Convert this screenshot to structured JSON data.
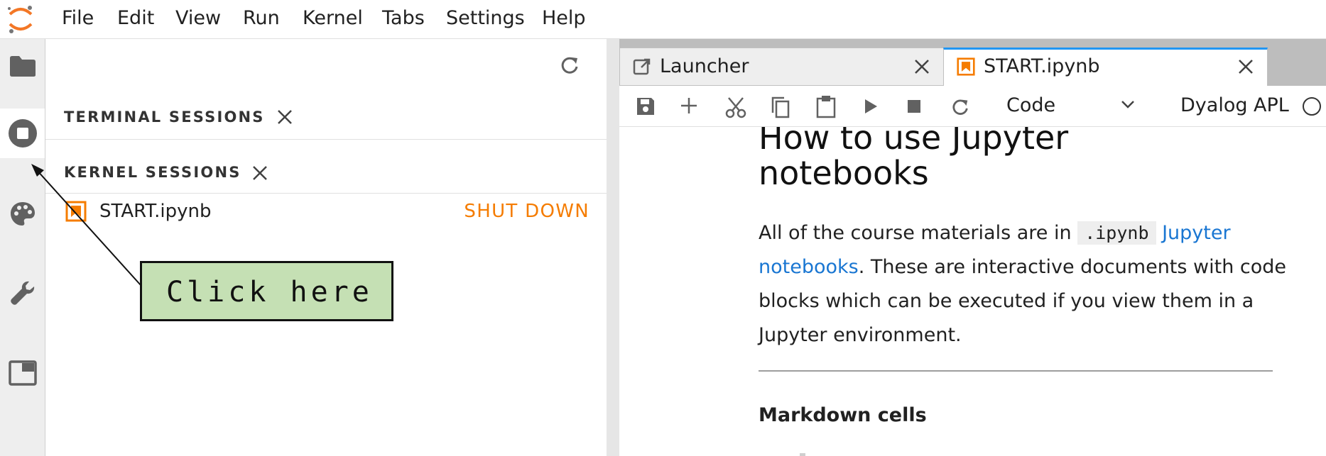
{
  "menubar": {
    "items": [
      "File",
      "Edit",
      "View",
      "Run",
      "Kernel",
      "Tabs",
      "Settings",
      "Help"
    ]
  },
  "sidebar": {
    "icons": [
      "folder-icon",
      "running-sessions-icon",
      "palette-icon",
      "wrench-icon",
      "tabs-icon"
    ],
    "terminal_title": "TERMINAL SESSIONS",
    "kernel_title": "KERNEL SESSIONS",
    "sessions": [
      {
        "name": "START.ipynb",
        "action": "SHUT DOWN"
      }
    ]
  },
  "tabs": [
    {
      "label": "Launcher",
      "icon": "launcher-icon",
      "active": false
    },
    {
      "label": "START.ipynb",
      "icon": "notebook-icon",
      "active": true
    }
  ],
  "toolbar": {
    "cell_type": "Code",
    "kernel_name": "Dyalog APL"
  },
  "notebook": {
    "heading": "How to use Jupyter notebooks",
    "para_1": "All of the course materials are in ",
    "para_code": ".ipynb",
    "para_link": "Jupyter notebooks",
    "para_2": ". These are interactive documents with code blocks which can be executed if you view them in a Jupyter environment.",
    "subheading": "Markdown cells"
  },
  "annotation": {
    "text": "Click here"
  },
  "colors": {
    "accent_orange": "#f57c00",
    "link_blue": "#1976d2",
    "active_tab_border": "#2196f3",
    "callout_fill": "#c5e0b4"
  }
}
